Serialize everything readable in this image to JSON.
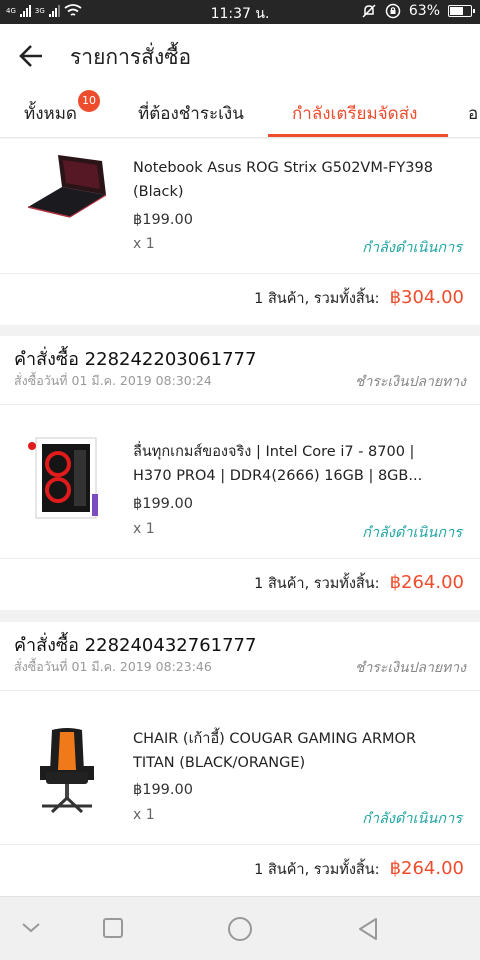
{
  "status_bar": {
    "network_top": "4G",
    "network_bottom": "3G",
    "time": "11:37 น.",
    "battery": "63%",
    "battery_level": 0.63
  },
  "header": {
    "title": "รายการสั่งซื้อ",
    "back_icon": "arrow-left-icon"
  },
  "tabs": [
    {
      "label": "ทั้งหมด",
      "badge": "10",
      "active": false
    },
    {
      "label": "ที่ต้องชำระเงิน",
      "active": false
    },
    {
      "label": "กำลังเตรียมจัดส่ง",
      "active": true
    },
    {
      "label": "อ",
      "active": false
    }
  ],
  "orders": [
    {
      "product_name_line1": "Notebook Asus ROG Strix G502VM-FY398",
      "product_name_line2": "(Black)",
      "price": "฿199.00",
      "qty": "x 1",
      "status": "กำลังดำเนินการ",
      "summary_label": "1 สินค้า, รวมทั้งสิ้น:",
      "total": "฿304.00"
    },
    {
      "order_no": "คำสั่งซื้อ 228242203061777",
      "order_date": "สั่งซื้อวันที่ 01 มี.ค. 2019  08:30:24",
      "payment": "ชำระเงินปลายทาง",
      "product_name_line1": "ลื่นทุกเกมส์ของจริง | Intel Core i7 - 8700 |",
      "product_name_line2": "H370 PRO4 | DDR4(2666) 16GB | 8GB...",
      "price": "฿199.00",
      "qty": "x 1",
      "status": "กำลังดำเนินการ",
      "summary_label": "1 สินค้า, รวมทั้งสิ้น:",
      "total": "฿264.00"
    },
    {
      "order_no": "คำสั่งซื้อ 228240432761777",
      "order_date": "สั่งซื้อวันที่ 01 มี.ค. 2019  08:23:46",
      "payment": "ชำระเงินปลายทาง",
      "product_name_line1": "CHAIR (เก้าอี้) COUGAR GAMING ARMOR",
      "product_name_line2": "TITAN (BLACK/ORANGE)",
      "price": "฿199.00",
      "qty": "x 1",
      "status": "กำลังดำเนินการ",
      "summary_label": "1 สินค้า, รวมทั้งสิ้น:",
      "total": "฿264.00"
    }
  ],
  "colors": {
    "accent": "#ee4d2d",
    "status_teal": "#25a6a3"
  },
  "nav_icons": [
    "chevron-down-icon",
    "square-icon",
    "circle-icon",
    "triangle-back-icon"
  ]
}
